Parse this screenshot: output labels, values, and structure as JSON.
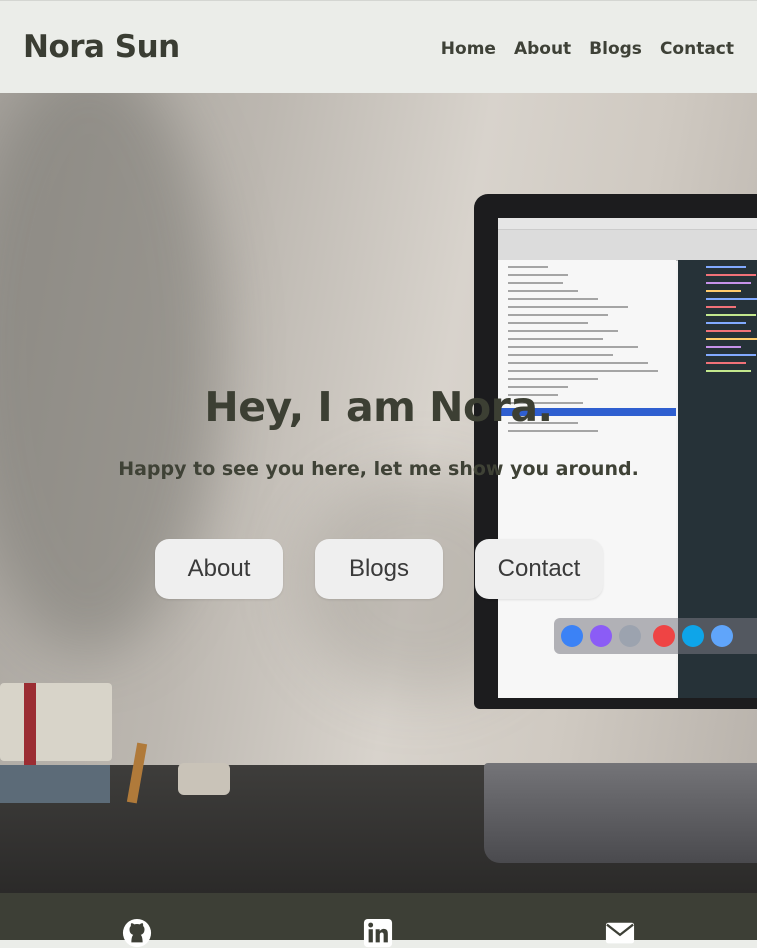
{
  "header": {
    "brand": "Nora Sun",
    "nav": [
      {
        "label": "Home"
      },
      {
        "label": "About"
      },
      {
        "label": "Blogs"
      },
      {
        "label": "Contact"
      }
    ]
  },
  "hero": {
    "greeting": "Hey, I am Nora.",
    "tagline": "Happy to see you here, let me show you around.",
    "buttons": [
      {
        "label": "About"
      },
      {
        "label": "Blogs"
      },
      {
        "label": "Contact"
      }
    ],
    "background_image": "desk-with-laptop-photo"
  },
  "footer": {
    "icons": [
      "github-icon",
      "linkedin-icon",
      "mail-icon"
    ]
  },
  "colors": {
    "header_bg": "#ebede9",
    "text_dark": "#3c3f33",
    "button_bg": "#efefef",
    "footer_bg": "#3d3f36",
    "footer_icon": "#ffffff"
  }
}
